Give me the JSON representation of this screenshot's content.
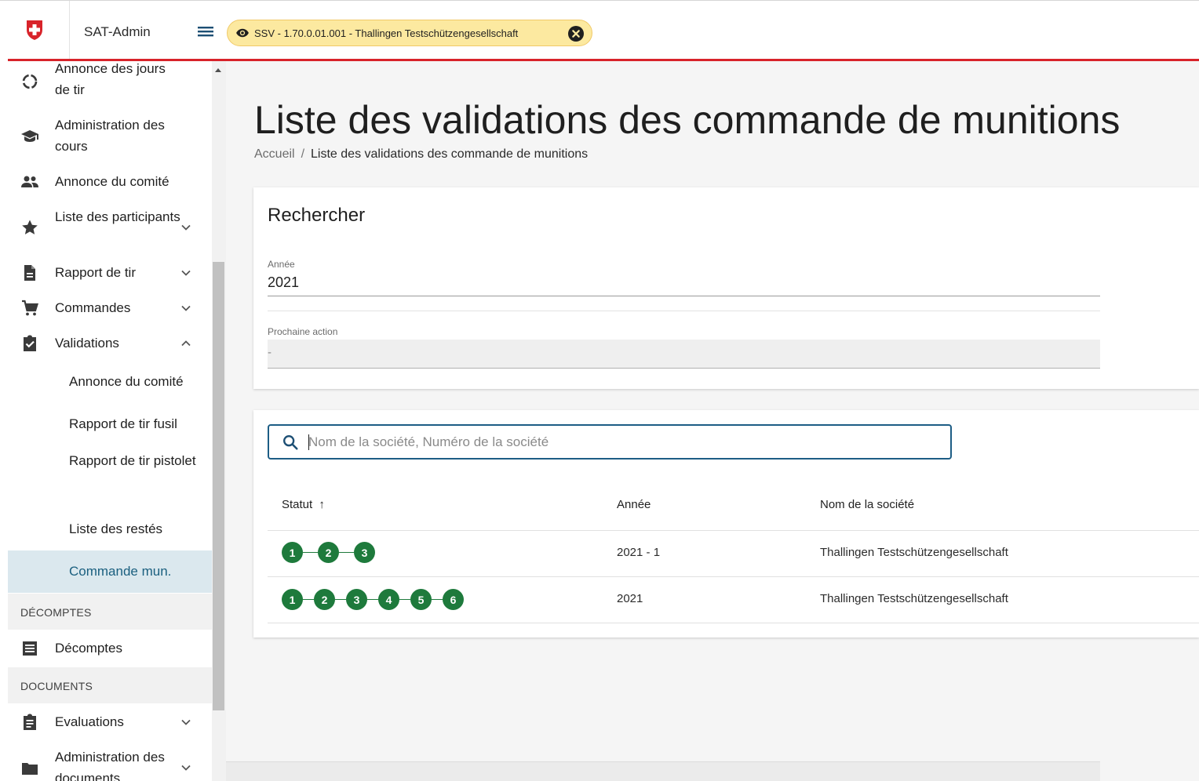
{
  "header": {
    "app_title": "SAT-Admin",
    "context_chip": "SSV - 1.70.0.01.001 - Thallingen Testschützengesellschaft",
    "brand_color": "#d8232a"
  },
  "sidebar": {
    "items": [
      {
        "label": "Annonce des jours de tir",
        "icon": "progress-icon"
      },
      {
        "label": "Administration des cours",
        "icon": "school-icon"
      },
      {
        "label": "Annonce du comité",
        "icon": "group-icon"
      },
      {
        "label": "Liste des participants",
        "icon": "star-icon"
      },
      {
        "label": "Rapport de tir",
        "icon": "document-icon"
      },
      {
        "label": "Commandes",
        "icon": "cart-icon"
      },
      {
        "label": "Validations",
        "icon": "clipboard-check-icon"
      }
    ],
    "validations_sub": [
      {
        "label": "Annonce du comité"
      },
      {
        "label": "Rapport de tir fusil"
      },
      {
        "label": "Rapport de tir pistolet"
      },
      {
        "label": "Liste des restés"
      },
      {
        "label": "Commande mun."
      }
    ],
    "section_decomptes": "DÉCOMPTES",
    "decomptes_item": "Décomptes",
    "section_documents": "DOCUMENTS",
    "documents_items": [
      {
        "label": "Evaluations"
      },
      {
        "label": "Administration des documents"
      }
    ]
  },
  "main": {
    "title": "Liste des validations des commande de munitions",
    "breadcrumb_home": "Accueil",
    "breadcrumb_sep": "/",
    "breadcrumb_current": "Liste des validations des commande de munitions",
    "search_card": {
      "title": "Rechercher",
      "year_label": "Année",
      "year_value": "2021",
      "next_action_label": "Prochaine action",
      "next_action_value": "-"
    },
    "table": {
      "search_placeholder": "Nom de la société, Numéro de la société",
      "columns": [
        "Statut",
        "Année",
        "Nom de la société"
      ],
      "sort_indicator": "↑",
      "rows": [
        {
          "steps": [
            "1",
            "2",
            "3"
          ],
          "year": "2021 - 1",
          "company": "Thallingen Testschützengesellschaft"
        },
        {
          "steps": [
            "1",
            "2",
            "3",
            "4",
            "5",
            "6"
          ],
          "year": "2021",
          "company": "Thallingen Testschützengesellschaft"
        }
      ],
      "step_color": "#1e7a3c"
    }
  }
}
